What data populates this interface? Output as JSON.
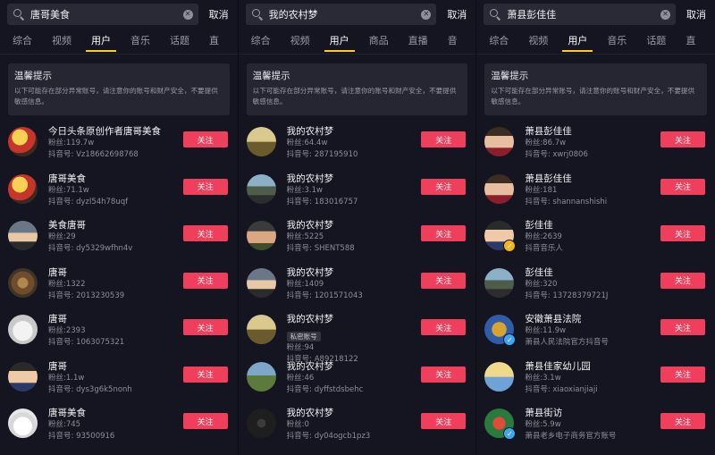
{
  "panels": [
    {
      "search": {
        "query": "唐哥美食",
        "cancel": "取消"
      },
      "tabs": [
        "综合",
        "视频",
        "用户",
        "音乐",
        "话题",
        "直"
      ],
      "active_tab": 2,
      "tip": {
        "title": "温馨提示",
        "body": "以下可能存在部分异常账号，请注意你的账号和财产安全，不要提供敏感信息。"
      },
      "users": [
        {
          "name": "今日头条原创作者唐哥美食",
          "fans": "粉丝:119.7w",
          "id": "抖音号: Vz18662698768",
          "avatar": "av-food",
          "button": "关注"
        },
        {
          "name": "唐哥美食",
          "fans": "粉丝:71.1w",
          "id": "抖音号: dyzl54h78uqf",
          "avatar": "av-food",
          "button": "关注"
        },
        {
          "name": "美食唐哥",
          "fans": "粉丝:29",
          "id": "抖音号: dy5329wfhn4v",
          "avatar": "av-person",
          "button": "关注"
        },
        {
          "name": "唐哥",
          "fans": "粉丝:1322",
          "id": "抖音号: 2013230539",
          "avatar": "av-dish",
          "button": "关注"
        },
        {
          "name": "唐哥",
          "fans": "粉丝:2393",
          "id": "抖音号: 1063075321",
          "avatar": "av-cat",
          "button": "关注"
        },
        {
          "name": "唐哥",
          "fans": "粉丝:1.1w",
          "id": "抖音号: dys3g6k5nonh",
          "avatar": "av-girl",
          "button": "关注"
        },
        {
          "name": "唐哥美食",
          "fans": "粉丝:745",
          "id": "抖音号: 93500916",
          "avatar": "av-chef",
          "button": "关注"
        }
      ]
    },
    {
      "search": {
        "query": "我的农村梦",
        "cancel": "取消"
      },
      "tabs": [
        "综合",
        "视频",
        "用户",
        "商品",
        "直播",
        "音"
      ],
      "active_tab": 2,
      "tip": {
        "title": "温馨提示",
        "body": "以下可能存在部分异常账号，请注意你的账号和财产安全，不要提供敏感信息。"
      },
      "users": [
        {
          "name": "我的农村梦",
          "fans": "粉丝:64.4w",
          "id": "抖音号: 287195910",
          "avatar": "av-village",
          "button": "关注"
        },
        {
          "name": "我的农村梦",
          "fans": "粉丝:3.1w",
          "id": "抖音号: 183016757",
          "avatar": "av-road",
          "button": "关注"
        },
        {
          "name": "我的农村梦",
          "fans": "粉丝:5225",
          "id": "抖音号: SHENT588",
          "avatar": "av-boy",
          "button": "关注"
        },
        {
          "name": "我的农村梦",
          "fans": "粉丝:1409",
          "id": "抖音号: 1201571043",
          "avatar": "av-person",
          "button": "关注"
        },
        {
          "name": "我的农村梦",
          "tag": "私密账号",
          "fans": "粉丝:94",
          "id": "抖音号: A89218122",
          "avatar": "av-village",
          "button": "关注"
        },
        {
          "name": "我的农村梦",
          "fans": "粉丝:46",
          "id": "抖音号: dyffstdsbehc",
          "avatar": "av-field",
          "button": "关注"
        },
        {
          "name": "我的农村梦",
          "fans": "粉丝:0",
          "id": "抖音号: dy04ogcb1pz3",
          "avatar": "av-dark",
          "button": "关注"
        }
      ]
    },
    {
      "search": {
        "query": "萧县彭佳佳",
        "cancel": "取消"
      },
      "tabs": [
        "综合",
        "视频",
        "用户",
        "音乐",
        "话题",
        "直"
      ],
      "active_tab": 2,
      "tip": {
        "title": "温馨提示",
        "body": "以下可能存在部分异常账号，请注意你的账号和财产安全，不要提供敏感信息。"
      },
      "users": [
        {
          "name": "萧县彭佳佳",
          "fans": "粉丝:86.7w",
          "id": "抖音号: xwrj0806",
          "avatar": "av-woman",
          "button": "关注"
        },
        {
          "name": "萧县彭佳佳",
          "fans": "粉丝:181",
          "id": "抖音号: shannanshishi",
          "avatar": "av-woman",
          "button": "关注"
        },
        {
          "name": "彭佳佳",
          "fans": "粉丝:2639",
          "id": "抖音音乐人",
          "avatar": "av-girl",
          "badge": "gold",
          "button": "关注"
        },
        {
          "name": "彭佳佳",
          "fans": "粉丝:320",
          "id": "抖音号: 13728379721J",
          "avatar": "av-road",
          "button": "关注"
        },
        {
          "name": "安徽萧县法院",
          "fans": "粉丝:11.9w",
          "id": "萧县人民法院官方抖音号",
          "avatar": "av-court",
          "badge": "blue",
          "button": "关注"
        },
        {
          "name": "萧县佳家幼儿园",
          "fans": "粉丝:3.1w",
          "id": "抖音号: xiaoxianjiaji",
          "avatar": "av-kids",
          "button": "关注"
        },
        {
          "name": "萧县街访",
          "fans": "粉丝:5.9w",
          "id": "萧县老乡电子商务官方账号",
          "avatar": "av-street",
          "badge": "blue",
          "button": "关注"
        }
      ]
    }
  ]
}
